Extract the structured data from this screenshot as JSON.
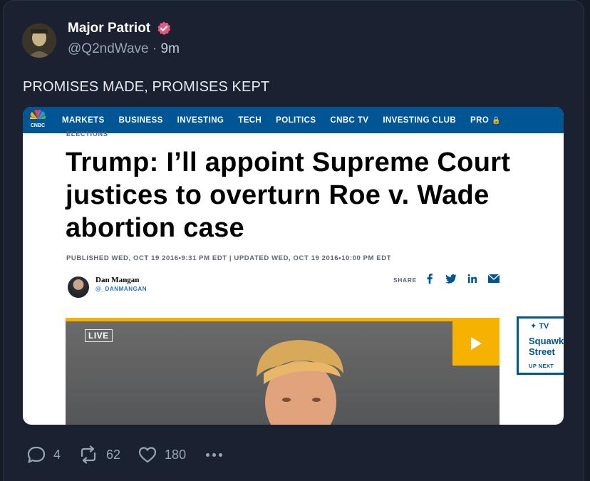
{
  "post": {
    "author_name": "Major Patriot",
    "handle": "@Q2ndWave",
    "separator": "·",
    "time": "9m",
    "text": "PROMISES MADE, PROMISES KEPT"
  },
  "embedded_article": {
    "nav_items": [
      "MARKETS",
      "BUSINESS",
      "INVESTING",
      "TECH",
      "POLITICS",
      "CNBC TV",
      "INVESTING CLUB",
      "PRO"
    ],
    "logo_text": "CNBC",
    "kicker": "ELECTIONS",
    "headline": "Trump: I’ll appoint Supreme Court justices to overturn Roe v. Wade abortion case",
    "dateline": "PUBLISHED WED, OCT 19 2016•9:31 PM EDT | UPDATED WED, OCT 19 2016•10:00 PM EDT",
    "author_name": "Dan Mangan",
    "author_handle": "@_DANMANGAN",
    "share_label": "SHARE",
    "video_badge": "LIVE",
    "tv_logo": "TV",
    "tv_show": "Squawk Street",
    "tv_next": "UP NEXT"
  },
  "actions": {
    "replies": "4",
    "reposts": "62",
    "likes": "180"
  },
  "colors": {
    "background": "#151b26",
    "card": "#1a2130",
    "verified": "#e8577e",
    "cnbc_blue": "#005594",
    "video_accent": "#f5b200"
  }
}
